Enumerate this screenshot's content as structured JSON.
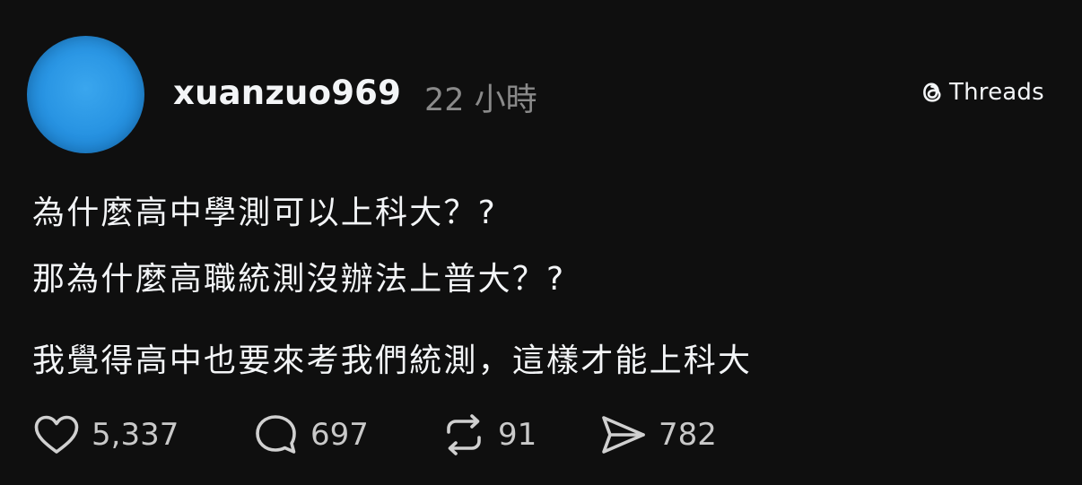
{
  "author": {
    "username": "xuanzuo969",
    "timestamp": "22 小時"
  },
  "brand": {
    "label": "Threads",
    "icon": "threads-logo-icon"
  },
  "post": {
    "lines": [
      "為什麼高中學測可以上科大？?",
      "那為什麼高職統測沒辦法上普大？?",
      "我覺得高中也要來考我們統測，這樣才能上科大"
    ]
  },
  "actions": {
    "like": {
      "icon": "heart-icon",
      "count": "5,337"
    },
    "reply": {
      "icon": "comment-bubble-icon",
      "count": "697"
    },
    "repost": {
      "icon": "repost-icon",
      "count": "91"
    },
    "share": {
      "icon": "send-icon",
      "count": "782"
    }
  },
  "colors": {
    "background": "#0f0f0f",
    "text": "#f3f5f7",
    "muted": "#8a8a8a",
    "avatar": "#2a96e4"
  }
}
